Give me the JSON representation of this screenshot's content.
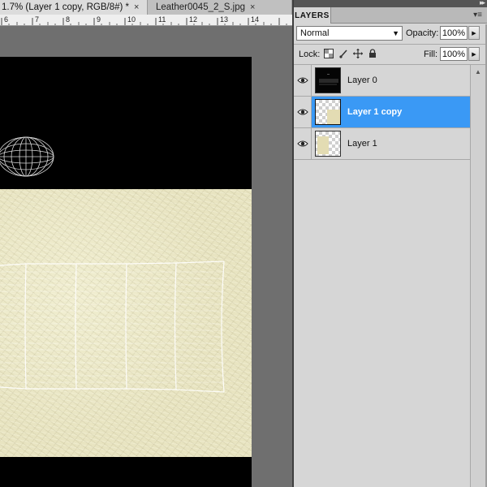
{
  "document": {
    "tabs": [
      {
        "title": "1.7% (Layer 1 copy, RGB/8#) *",
        "close": "×",
        "active": true
      },
      {
        "title": "Leather0045_2_S.jpg",
        "close": "×",
        "active": false
      }
    ],
    "ruler_labels": [
      "6",
      "7",
      "8",
      "9",
      "10",
      "11",
      "12",
      "13",
      "14"
    ]
  },
  "layers_panel": {
    "tab_label": "LAYERS",
    "collapse_glyph": "▸▸",
    "menu_glyph": "▾≡",
    "blend_mode": "Normal",
    "opacity_label": "Opacity:",
    "opacity_value": "100%",
    "lock_label": "Lock:",
    "fill_label": "Fill:",
    "fill_value": "100%",
    "flyout_arrow": "▶",
    "scroll_up_glyph": "▲",
    "layers": [
      {
        "name": "Layer 0",
        "visible": true,
        "selected": false,
        "thumb": "dark"
      },
      {
        "name": "Layer 1 copy",
        "visible": true,
        "selected": true,
        "thumb": "leather-checker"
      },
      {
        "name": "Layer 1",
        "visible": true,
        "selected": false,
        "thumb": "leather-checker-small"
      }
    ]
  },
  "icons": {
    "visibility": "eye-icon",
    "lock_transparent": "lock-transparent-pixels-icon",
    "lock_image": "lock-image-pixels-icon",
    "lock_position": "lock-position-icon",
    "lock_all": "lock-all-icon"
  },
  "colors": {
    "selection": "#3a99f5",
    "leather": "#e8e4c1",
    "panel_bg": "#d6d6d6",
    "canvas_bg": "#000000"
  }
}
